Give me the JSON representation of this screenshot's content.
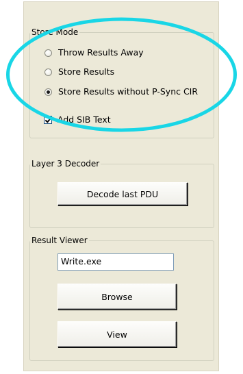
{
  "store_mode": {
    "title": "Store Mode",
    "options": [
      {
        "label": "Throw Results Away",
        "checked": false
      },
      {
        "label": "Store Results",
        "checked": false
      },
      {
        "label": "Store Results without P-Sync CIR",
        "checked": true
      }
    ],
    "sib_checkbox": {
      "label": "Add SIB Text",
      "checked": true
    }
  },
  "layer3_decoder": {
    "title": "Layer 3 Decoder",
    "decode_button_label": "Decode last PDU"
  },
  "result_viewer": {
    "title": "Result Viewer",
    "file_value": "Write.exe",
    "browse_button_label": "Browse",
    "view_button_label": "View"
  },
  "annotation": {
    "highlight_color": "#19d6e6"
  }
}
